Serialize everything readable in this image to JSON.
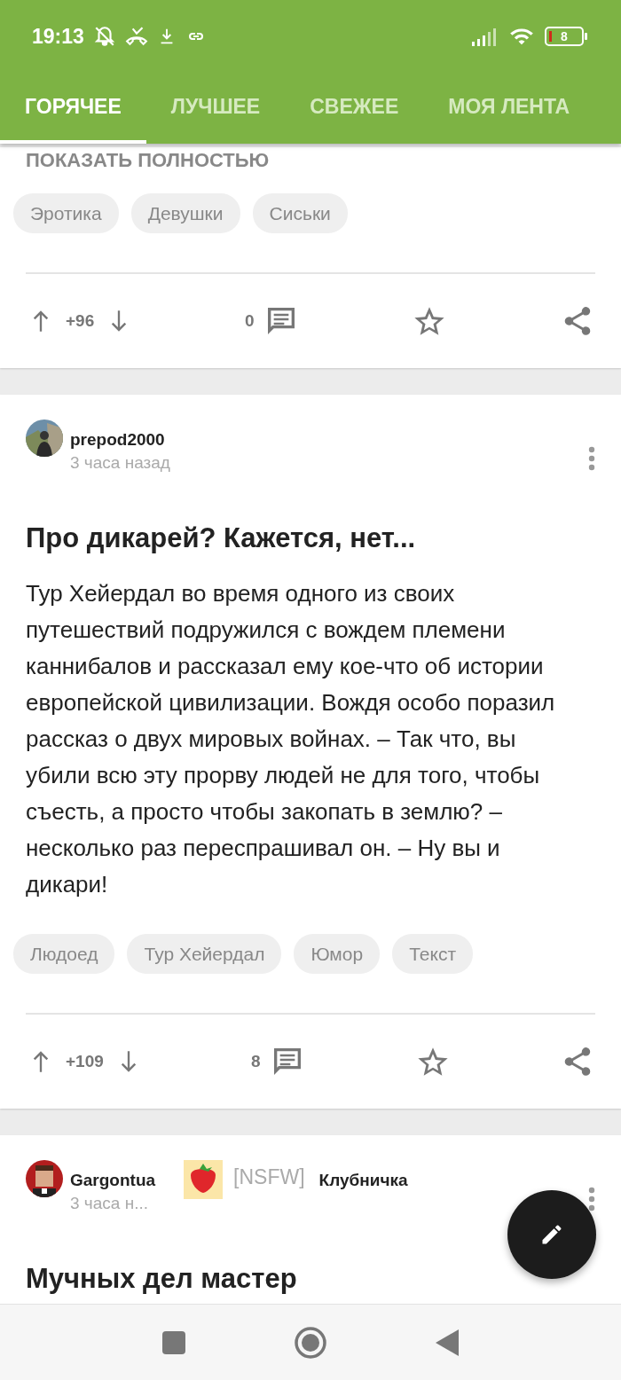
{
  "status_bar": {
    "time": "19:13",
    "battery": "8"
  },
  "tabs": [
    {
      "label": "ГОРЯЧЕЕ",
      "selected": true
    },
    {
      "label": "ЛУЧШЕЕ",
      "selected": false
    },
    {
      "label": "СВЕЖЕЕ",
      "selected": false
    },
    {
      "label": "МОЯ ЛЕНТА",
      "selected": false
    }
  ],
  "posts": [
    {
      "show_more": "ПОКАЗАТЬ ПОЛНОСТЬЮ",
      "tags": [
        "Эротика",
        "Девушки",
        "Сиськи"
      ],
      "rating": "+96",
      "comments": "0"
    },
    {
      "author": "prepod2000",
      "time": "3 часа назад",
      "title": "Про дикарей? Кажется, нет...",
      "body": "Тур Хейердал во время одного из своих путешествий подружился с вождем племени каннибалов и рассказал ему кое-что об истории европейской цивилизации. Вождя особо поразил рассказ о двух мировых войнах. – Так что, вы убили всю эту прорву людей не для того, чтобы съесть, а просто чтобы закопать в землю? – несколько раз переспрашивал он. – Ну вы и дикари!",
      "tags": [
        "Людоед",
        "Тур Хейердал",
        "Юмор",
        "Текст"
      ],
      "rating": "+109",
      "comments": "8"
    },
    {
      "author": "Gargontua",
      "time": "3 часа н...",
      "flag": "[NSFW]",
      "community": "Клубничка",
      "title": "Мучных дел мастер"
    }
  ]
}
